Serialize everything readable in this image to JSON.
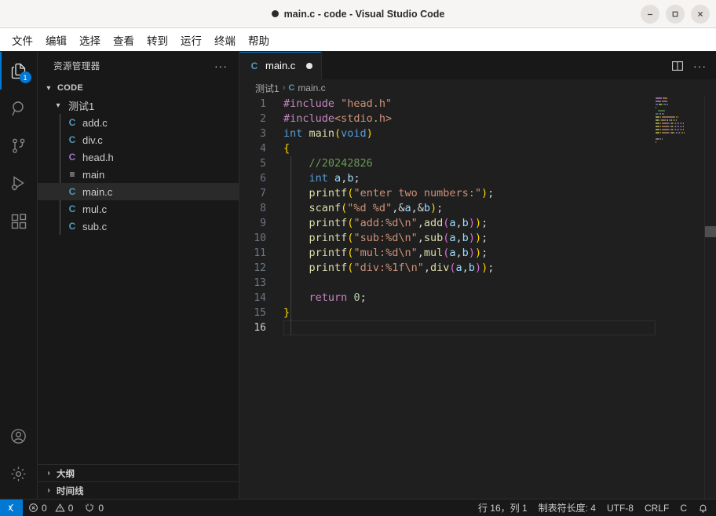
{
  "window": {
    "title": "main.c - code - Visual Studio Code",
    "dirty_indicator": "dirty-dot",
    "controls": {
      "minimize": "minimize-icon",
      "maximize": "maximize-icon",
      "close": "close-icon"
    }
  },
  "menubar": {
    "items": [
      {
        "label": "文件"
      },
      {
        "label": "编辑"
      },
      {
        "label": "选择"
      },
      {
        "label": "查看"
      },
      {
        "label": "转到"
      },
      {
        "label": "运行"
      },
      {
        "label": "终端"
      },
      {
        "label": "帮助"
      }
    ]
  },
  "activitybar": {
    "items": [
      {
        "name": "explorer",
        "icon": "files-icon",
        "active": true,
        "badge": "1"
      },
      {
        "name": "search",
        "icon": "search-icon",
        "active": false,
        "badge": ""
      },
      {
        "name": "source-control",
        "icon": "source-control-icon",
        "active": false,
        "badge": ""
      },
      {
        "name": "run-and-debug",
        "icon": "run-debug-icon",
        "active": false,
        "badge": ""
      },
      {
        "name": "extensions",
        "icon": "extensions-icon",
        "active": false,
        "badge": ""
      }
    ],
    "bottom": [
      {
        "name": "accounts",
        "icon": "account-icon"
      },
      {
        "name": "settings",
        "icon": "gear-icon"
      }
    ]
  },
  "sidebar": {
    "title": "资源管理器",
    "more_actions": "···",
    "root": {
      "label": "CODE",
      "expanded": true,
      "chevron": "▾"
    },
    "folder": {
      "label": "测试1",
      "expanded": true,
      "chevron": "▾"
    },
    "files": [
      {
        "name": "add.c",
        "icon": "c-file-icon",
        "icon_glyph": "C",
        "icon_color": "c-blue",
        "selected": false
      },
      {
        "name": "div.c",
        "icon": "c-file-icon",
        "icon_glyph": "C",
        "icon_color": "c-blue",
        "selected": false
      },
      {
        "name": "head.h",
        "icon": "h-file-icon",
        "icon_glyph": "C",
        "icon_color": "c-purple",
        "selected": false
      },
      {
        "name": "main",
        "icon": "binary-file-icon",
        "icon_glyph": "≡",
        "icon_color": "c-grey",
        "selected": false
      },
      {
        "name": "main.c",
        "icon": "c-file-icon",
        "icon_glyph": "C",
        "icon_color": "c-blue",
        "selected": true
      },
      {
        "name": "mul.c",
        "icon": "c-file-icon",
        "icon_glyph": "C",
        "icon_color": "c-blue",
        "selected": false
      },
      {
        "name": "sub.c",
        "icon": "c-file-icon",
        "icon_glyph": "C",
        "icon_color": "c-blue",
        "selected": false
      }
    ],
    "panels": [
      {
        "label": "大纲",
        "chevron": "›",
        "expanded": false
      },
      {
        "label": "时间线",
        "chevron": "›",
        "expanded": false
      }
    ]
  },
  "editor": {
    "tab": {
      "label": "main.c",
      "icon_glyph": "C",
      "dirty": true
    },
    "actions": {
      "split": "split-editor-icon",
      "more": "···"
    },
    "breadcrumbs": [
      {
        "label": "测试1",
        "type": "folder"
      },
      {
        "label": "main.c",
        "type": "file",
        "icon_glyph": "C"
      }
    ],
    "lines": [
      {
        "n": "1",
        "tokens": [
          {
            "t": "#include ",
            "c": "t-pre"
          },
          {
            "t": "\"head.h\"",
            "c": "t-str"
          }
        ]
      },
      {
        "n": "2",
        "tokens": [
          {
            "t": "#include",
            "c": "t-pre"
          },
          {
            "t": "<stdio.h>",
            "c": "t-str"
          }
        ]
      },
      {
        "n": "3",
        "tokens": [
          {
            "t": "int ",
            "c": "t-key"
          },
          {
            "t": "main",
            "c": "t-fn"
          },
          {
            "t": "(",
            "c": "t-br1"
          },
          {
            "t": "void",
            "c": "t-key"
          },
          {
            "t": ")",
            "c": "t-br1"
          }
        ]
      },
      {
        "n": "4",
        "tokens": [
          {
            "t": "{",
            "c": "t-br1"
          }
        ]
      },
      {
        "n": "5",
        "tokens": [
          {
            "t": "    //20242826",
            "c": "t-cmt"
          }
        ]
      },
      {
        "n": "6",
        "tokens": [
          {
            "t": "    ",
            "c": "t-pl"
          },
          {
            "t": "int",
            "c": "t-key"
          },
          {
            "t": " ",
            "c": "t-pl"
          },
          {
            "t": "a",
            "c": "t-var"
          },
          {
            "t": ",",
            "c": "t-pl"
          },
          {
            "t": "b",
            "c": "t-var"
          },
          {
            "t": ";",
            "c": "t-pl"
          }
        ]
      },
      {
        "n": "7",
        "tokens": [
          {
            "t": "    ",
            "c": "t-pl"
          },
          {
            "t": "printf",
            "c": "t-fn"
          },
          {
            "t": "(",
            "c": "t-br1"
          },
          {
            "t": "\"enter two numbers:\"",
            "c": "t-str"
          },
          {
            "t": ")",
            "c": "t-br1"
          },
          {
            "t": ";",
            "c": "t-pl"
          }
        ]
      },
      {
        "n": "8",
        "tokens": [
          {
            "t": "    ",
            "c": "t-pl"
          },
          {
            "t": "scanf",
            "c": "t-fn"
          },
          {
            "t": "(",
            "c": "t-br1"
          },
          {
            "t": "\"%d %d\"",
            "c": "t-str"
          },
          {
            "t": ",&",
            "c": "t-pl"
          },
          {
            "t": "a",
            "c": "t-var"
          },
          {
            "t": ",&",
            "c": "t-pl"
          },
          {
            "t": "b",
            "c": "t-var"
          },
          {
            "t": ")",
            "c": "t-br1"
          },
          {
            "t": ";",
            "c": "t-pl"
          }
        ]
      },
      {
        "n": "9",
        "tokens": [
          {
            "t": "    ",
            "c": "t-pl"
          },
          {
            "t": "printf",
            "c": "t-fn"
          },
          {
            "t": "(",
            "c": "t-br1"
          },
          {
            "t": "\"add:%d\\n\"",
            "c": "t-str"
          },
          {
            "t": ",",
            "c": "t-pl"
          },
          {
            "t": "add",
            "c": "t-fn"
          },
          {
            "t": "(",
            "c": "t-br2"
          },
          {
            "t": "a",
            "c": "t-var"
          },
          {
            "t": ",",
            "c": "t-pl"
          },
          {
            "t": "b",
            "c": "t-var"
          },
          {
            "t": ")",
            "c": "t-br2"
          },
          {
            "t": ")",
            "c": "t-br1"
          },
          {
            "t": ";",
            "c": "t-pl"
          }
        ]
      },
      {
        "n": "10",
        "tokens": [
          {
            "t": "    ",
            "c": "t-pl"
          },
          {
            "t": "printf",
            "c": "t-fn"
          },
          {
            "t": "(",
            "c": "t-br1"
          },
          {
            "t": "\"sub:%d\\n\"",
            "c": "t-str"
          },
          {
            "t": ",",
            "c": "t-pl"
          },
          {
            "t": "sub",
            "c": "t-fn"
          },
          {
            "t": "(",
            "c": "t-br2"
          },
          {
            "t": "a",
            "c": "t-var"
          },
          {
            "t": ",",
            "c": "t-pl"
          },
          {
            "t": "b",
            "c": "t-var"
          },
          {
            "t": ")",
            "c": "t-br2"
          },
          {
            "t": ")",
            "c": "t-br1"
          },
          {
            "t": ";",
            "c": "t-pl"
          }
        ]
      },
      {
        "n": "11",
        "tokens": [
          {
            "t": "    ",
            "c": "t-pl"
          },
          {
            "t": "printf",
            "c": "t-fn"
          },
          {
            "t": "(",
            "c": "t-br1"
          },
          {
            "t": "\"mul:%d\\n\"",
            "c": "t-str"
          },
          {
            "t": ",",
            "c": "t-pl"
          },
          {
            "t": "mul",
            "c": "t-fn"
          },
          {
            "t": "(",
            "c": "t-br2"
          },
          {
            "t": "a",
            "c": "t-var"
          },
          {
            "t": ",",
            "c": "t-pl"
          },
          {
            "t": "b",
            "c": "t-var"
          },
          {
            "t": ")",
            "c": "t-br2"
          },
          {
            "t": ")",
            "c": "t-br1"
          },
          {
            "t": ";",
            "c": "t-pl"
          }
        ]
      },
      {
        "n": "12",
        "tokens": [
          {
            "t": "    ",
            "c": "t-pl"
          },
          {
            "t": "printf",
            "c": "t-fn"
          },
          {
            "t": "(",
            "c": "t-br1"
          },
          {
            "t": "\"div:%1f\\n\"",
            "c": "t-str"
          },
          {
            "t": ",",
            "c": "t-pl"
          },
          {
            "t": "div",
            "c": "t-fn"
          },
          {
            "t": "(",
            "c": "t-br2"
          },
          {
            "t": "a",
            "c": "t-var"
          },
          {
            "t": ",",
            "c": "t-pl"
          },
          {
            "t": "b",
            "c": "t-var"
          },
          {
            "t": ")",
            "c": "t-br2"
          },
          {
            "t": ")",
            "c": "t-br1"
          },
          {
            "t": ";",
            "c": "t-pl"
          }
        ]
      },
      {
        "n": "13",
        "tokens": []
      },
      {
        "n": "14",
        "tokens": [
          {
            "t": "    ",
            "c": "t-pl"
          },
          {
            "t": "return",
            "c": "t-pre"
          },
          {
            "t": " ",
            "c": "t-pl"
          },
          {
            "t": "0",
            "c": "t-num"
          },
          {
            "t": ";",
            "c": "t-pl"
          }
        ]
      },
      {
        "n": "15",
        "tokens": [
          {
            "t": "}",
            "c": "t-br1"
          }
        ]
      },
      {
        "n": "16",
        "tokens": [],
        "current": true
      }
    ]
  },
  "statusbar": {
    "remote_icon": "remote-indicator-icon",
    "left": [
      {
        "name": "problems-errors",
        "icon": "error-icon",
        "label": "0"
      },
      {
        "name": "problems-warnings",
        "icon": "warning-icon",
        "label": "0"
      },
      {
        "name": "ports",
        "icon": "ports-icon",
        "label": "0"
      }
    ],
    "right": [
      {
        "name": "editor-position",
        "label": "行 16，列 1"
      },
      {
        "name": "editor-indentation",
        "label": "制表符长度: 4"
      },
      {
        "name": "editor-encoding",
        "label": "UTF-8"
      },
      {
        "name": "editor-eol",
        "label": "CRLF"
      },
      {
        "name": "editor-language",
        "label": "C"
      },
      {
        "name": "notifications",
        "icon": "bell-icon",
        "label": ""
      }
    ]
  },
  "colors": {
    "accent": "#0078d4",
    "editor_bg": "#1f1f1f",
    "sidebar_bg": "#181818",
    "titlebar_bg": "#f6f5f4"
  }
}
